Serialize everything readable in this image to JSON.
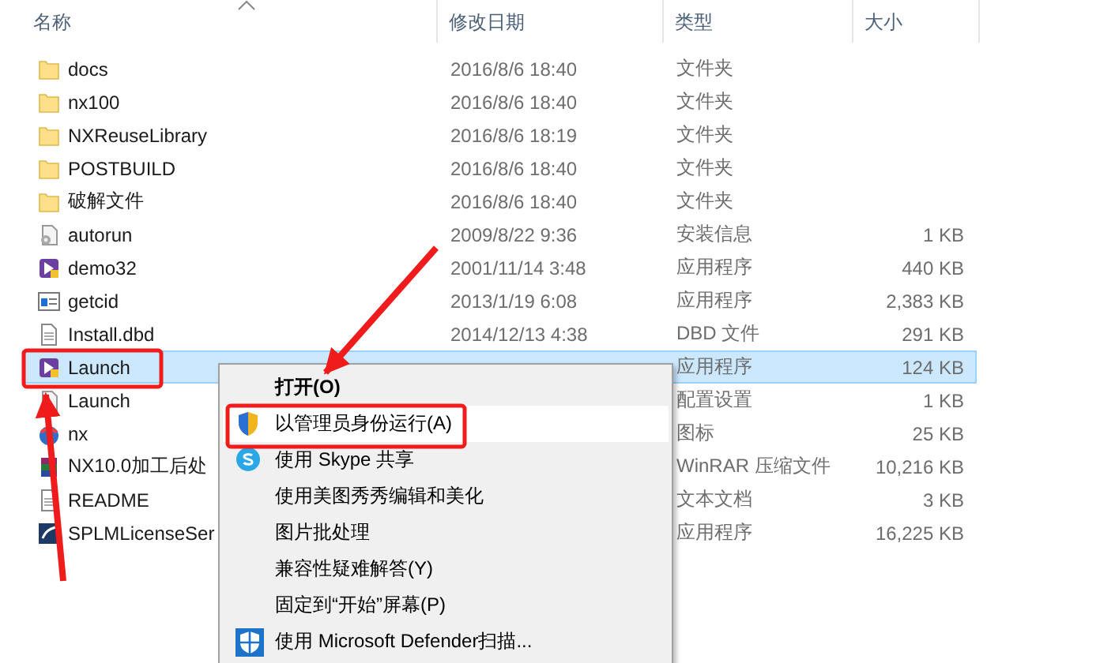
{
  "columns": [
    {
      "label": "名称",
      "sorted": true
    },
    {
      "label": "修改日期",
      "sorted": false
    },
    {
      "label": "类型",
      "sorted": false
    },
    {
      "label": "大小",
      "sorted": false
    }
  ],
  "rows": [
    {
      "kind": "folder",
      "name": "docs",
      "date": "2016/8/6 18:40",
      "type": "文件夹",
      "selected": false
    },
    {
      "kind": "folder",
      "name": "nx100",
      "date": "2016/8/6 18:40",
      "type": "文件夹",
      "selected": false
    },
    {
      "kind": "folder",
      "name": "NXReuseLibrary",
      "date": "2016/8/6 18:19",
      "type": "文件夹",
      "selected": false
    },
    {
      "kind": "folder",
      "name": "POSTBUILD",
      "date": "2016/8/6 18:40",
      "type": "文件夹",
      "selected": false
    },
    {
      "kind": "folder",
      "name": "破解文件",
      "date": "2016/8/6 18:40",
      "type": "文件夹",
      "selected": false
    },
    {
      "kind": "settings",
      "name": "autorun",
      "date": "2009/8/22 9:36",
      "type": "安装信息",
      "size": "1 KB",
      "selected": false
    },
    {
      "kind": "app",
      "name": "demo32",
      "date": "2001/11/14 3:48",
      "type": "应用程序",
      "size": "440 KB",
      "selected": false
    },
    {
      "kind": "window",
      "name": "getcid",
      "date": "2013/1/19 6:08",
      "type": "应用程序",
      "size": "2,383 KB",
      "selected": false
    },
    {
      "kind": "document",
      "name": "Install.dbd",
      "date": "2014/12/13 4:38",
      "type": "DBD 文件",
      "size": "291 KB",
      "selected": false
    },
    {
      "kind": "app",
      "name": "Launch",
      "type": "应用程序",
      "size": "124 KB",
      "selected": true
    },
    {
      "kind": "settings",
      "name": "Launch",
      "type": "配置设置",
      "size": "1 KB",
      "selected": false
    },
    {
      "kind": "globe",
      "name": "nx",
      "type": "图标",
      "size": "25 KB",
      "selected": false
    },
    {
      "kind": "archive",
      "name": "NX10.0加工后处",
      "type": "WinRAR 压缩文件",
      "size": "10,216 KB",
      "selected": false
    },
    {
      "kind": "document",
      "name": "README",
      "type": "文本文档",
      "size": "3 KB",
      "selected": false
    },
    {
      "kind": "server",
      "name": "SPLMLicenseSer",
      "type": "应用程序",
      "size": "16,225 KB",
      "selected": false
    }
  ],
  "context_menu": {
    "items": [
      {
        "label": "打开(O)",
        "kind": "plain",
        "bold": true,
        "selected": false
      },
      {
        "label": "以管理员身份运行(A)",
        "kind": "shield",
        "bold": false,
        "selected": true
      },
      {
        "label": "使用 Skype 共享",
        "kind": "skype",
        "bold": false,
        "selected": false
      },
      {
        "label": "使用美图秀秀编辑和美化",
        "kind": "plain",
        "bold": false,
        "selected": false
      },
      {
        "label": "图片批处理",
        "kind": "plain",
        "bold": false,
        "selected": false
      },
      {
        "label": "兼容性疑难解答(Y)",
        "kind": "plain",
        "bold": false,
        "selected": false
      },
      {
        "label": "固定到“开始”屏幕(P)",
        "kind": "plain",
        "bold": false,
        "selected": false
      },
      {
        "label": "使用 Microsoft Defender扫描...",
        "kind": "defender",
        "bold": false,
        "selected": false
      }
    ]
  }
}
